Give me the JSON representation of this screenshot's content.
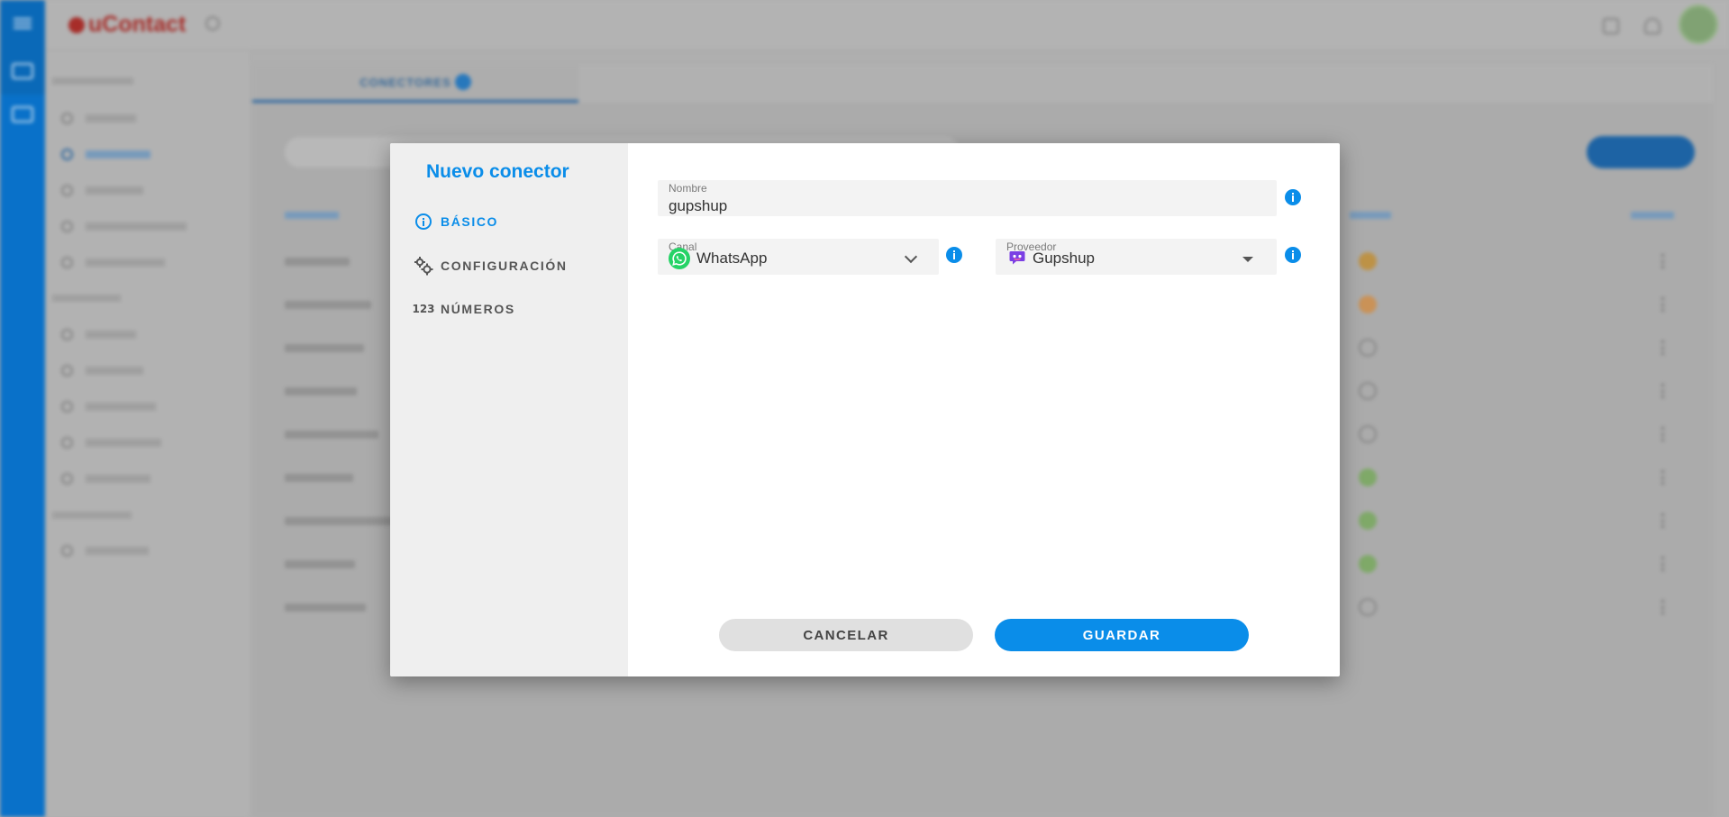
{
  "app": {
    "logo": "uContact",
    "tab_label": "CONECTORES",
    "sidebar": {
      "sections": [
        {
          "label": "",
          "items": [
            "",
            "",
            "",
            "",
            ""
          ]
        },
        {
          "label": "",
          "items": [
            "",
            "",
            "",
            "",
            ""
          ]
        },
        {
          "label": "",
          "items": [
            ""
          ]
        }
      ]
    }
  },
  "modal": {
    "title": "Nuevo conector",
    "steps": [
      {
        "label": "BÁSICO",
        "active": true,
        "icon": "info-circle-icon"
      },
      {
        "label": "CONFIGURACIÓN",
        "active": false,
        "icon": "gears-icon"
      },
      {
        "label": "NÚMEROS",
        "active": false,
        "icon": "numbers-icon",
        "glyph": "123"
      }
    ],
    "fields": {
      "nombre": {
        "label": "Nombre",
        "value": "gupshup"
      },
      "canal": {
        "label": "Canal",
        "value": "WhatsApp",
        "icon": "whatsapp-icon"
      },
      "proveedor": {
        "label": "Proveedor",
        "value": "Gupshup",
        "icon": "gupshup-icon"
      }
    },
    "buttons": {
      "cancel": "CANCELAR",
      "save": "GUARDAR"
    }
  },
  "colors": {
    "accent": "#0a8de9",
    "rail": "#0a78d4",
    "whatsapp": "#25d366",
    "gupshup": "#7b3fe4"
  }
}
